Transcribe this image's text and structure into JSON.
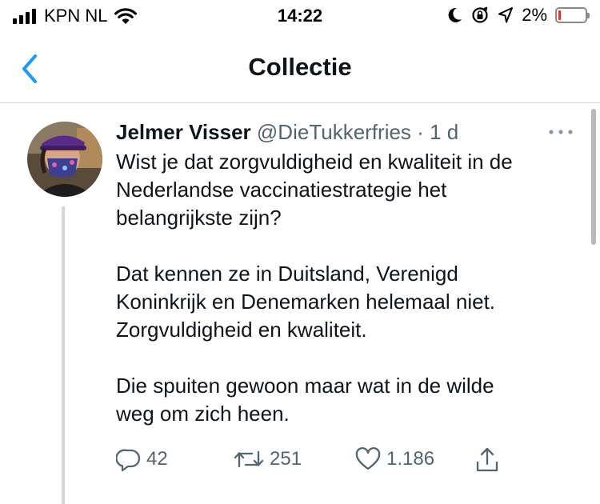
{
  "status_bar": {
    "carrier": "KPN NL",
    "time": "14:22",
    "battery_percent": "2%",
    "battery_level": 0.02,
    "icons": [
      "signal-icon",
      "wifi-icon",
      "moon-icon",
      "rotation-lock-icon",
      "location-arrow-icon",
      "battery-icon"
    ]
  },
  "nav": {
    "title": "Collectie",
    "back_icon": "chevron-left-icon"
  },
  "tweet": {
    "name": "Jelmer Visser",
    "handle": "@DieTukkerfries",
    "separator": "·",
    "time": "1 d",
    "more_icon": "more-dots-icon",
    "paragraphs": [
      [
        "Wist je dat zorgvuldigheid en kwaliteit in de",
        "Nederlandse vaccinatiestrategie het",
        "belangrijkste zijn?"
      ],
      [
        "Dat kennen ze in Duitsland, Verenigd",
        "Koninkrijk en Denemarken helemaal niet.",
        "Zorgvuldigheid en kwaliteit."
      ],
      [
        "Die spuiten gewoon maar wat in de wilde",
        "weg om zich heen."
      ]
    ],
    "actions": {
      "reply_count": "42",
      "retweet_count": "251",
      "like_count": "1.186"
    }
  },
  "colors": {
    "accent": "#1d9bf0",
    "text": "#0f1419",
    "muted": "#536471",
    "thread_line": "#cfd9de",
    "battery_low": "#e0312b"
  }
}
